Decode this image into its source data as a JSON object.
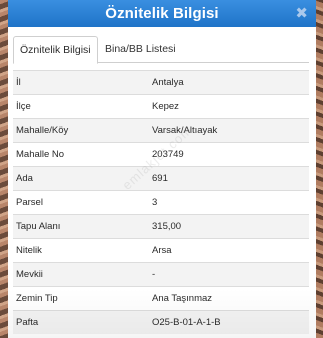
{
  "dialog": {
    "title": "Öznitelik Bilgisi",
    "close_glyph": "✖",
    "close_icon": "close-icon"
  },
  "tabs": [
    {
      "label": "Öznitelik Bilgisi",
      "active": true
    },
    {
      "label": "Bina/BB Listesi",
      "active": false
    }
  ],
  "attributes": [
    {
      "key": "İl",
      "value": "Antalya"
    },
    {
      "key": "İlçe",
      "value": "Kepez"
    },
    {
      "key": "Mahalle/Köy",
      "value": "Varsak/Altıayak"
    },
    {
      "key": "Mahalle No",
      "value": "203749"
    },
    {
      "key": "Ada",
      "value": "691"
    },
    {
      "key": "Parsel",
      "value": "3"
    },
    {
      "key": "Tapu Alanı",
      "value": "315,00"
    },
    {
      "key": "Nitelik",
      "value": "Arsa"
    },
    {
      "key": "Mevkii",
      "value": "-"
    },
    {
      "key": "Zemin Tip",
      "value": "Ana Taşınmaz"
    },
    {
      "key": "Pafta",
      "value": "O25-B-01-A-1-B"
    }
  ],
  "watermark": "emlakjet.com",
  "colors": {
    "titlebar": "#2a7fd4",
    "row_alt": "#f3f3f3"
  }
}
